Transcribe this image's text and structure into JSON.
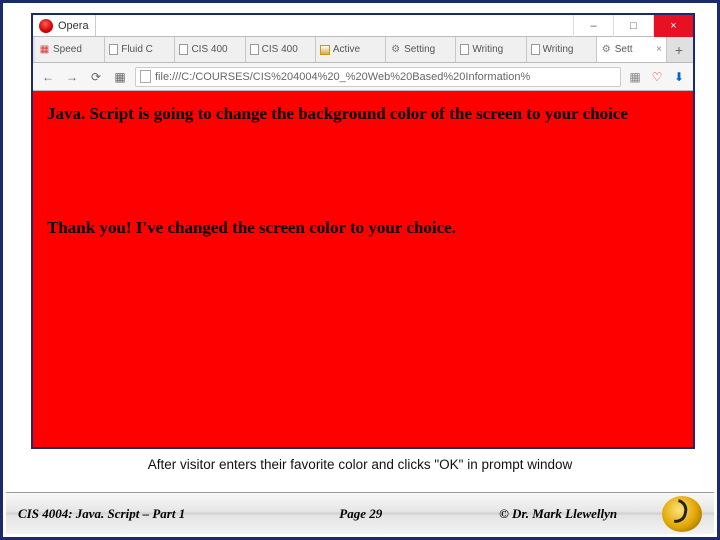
{
  "window": {
    "app_name": "Opera",
    "controls": {
      "minimize": "–",
      "maximize": "□",
      "close": "×"
    }
  },
  "tabs": [
    {
      "icon": "speed",
      "label": "Speed "
    },
    {
      "icon": "page",
      "label": "Fluid C"
    },
    {
      "icon": "page",
      "label": "CIS 400"
    },
    {
      "icon": "page",
      "label": "CIS 400"
    },
    {
      "icon": "img",
      "label": "Active "
    },
    {
      "icon": "gear",
      "label": "Setting"
    },
    {
      "icon": "page",
      "label": "Writing"
    },
    {
      "icon": "page",
      "label": "Writing"
    },
    {
      "icon": "gear",
      "label": "Sett",
      "active": true,
      "closeable": true
    }
  ],
  "newtab_label": "+",
  "toolbar": {
    "back": "←",
    "forward": "→",
    "reload": "⟳",
    "speed": "▦",
    "url": "file:///C:/COURSES/CIS%204004%20_%20Web%20Based%20Information%",
    "bookmark": "▦",
    "heart": "♡",
    "download": "⬇"
  },
  "page": {
    "heading": "Java. Script is going to change the background color of the screen to your choice",
    "message": "Thank you! I've changed the screen color to your choice."
  },
  "caption": "After visitor enters their favorite color and clicks \"OK\" in prompt window",
  "footer": {
    "course": "CIS 4004: Java. Script – Part 1",
    "page": "Page 29",
    "copyright": "© Dr. Mark Llewellyn"
  }
}
